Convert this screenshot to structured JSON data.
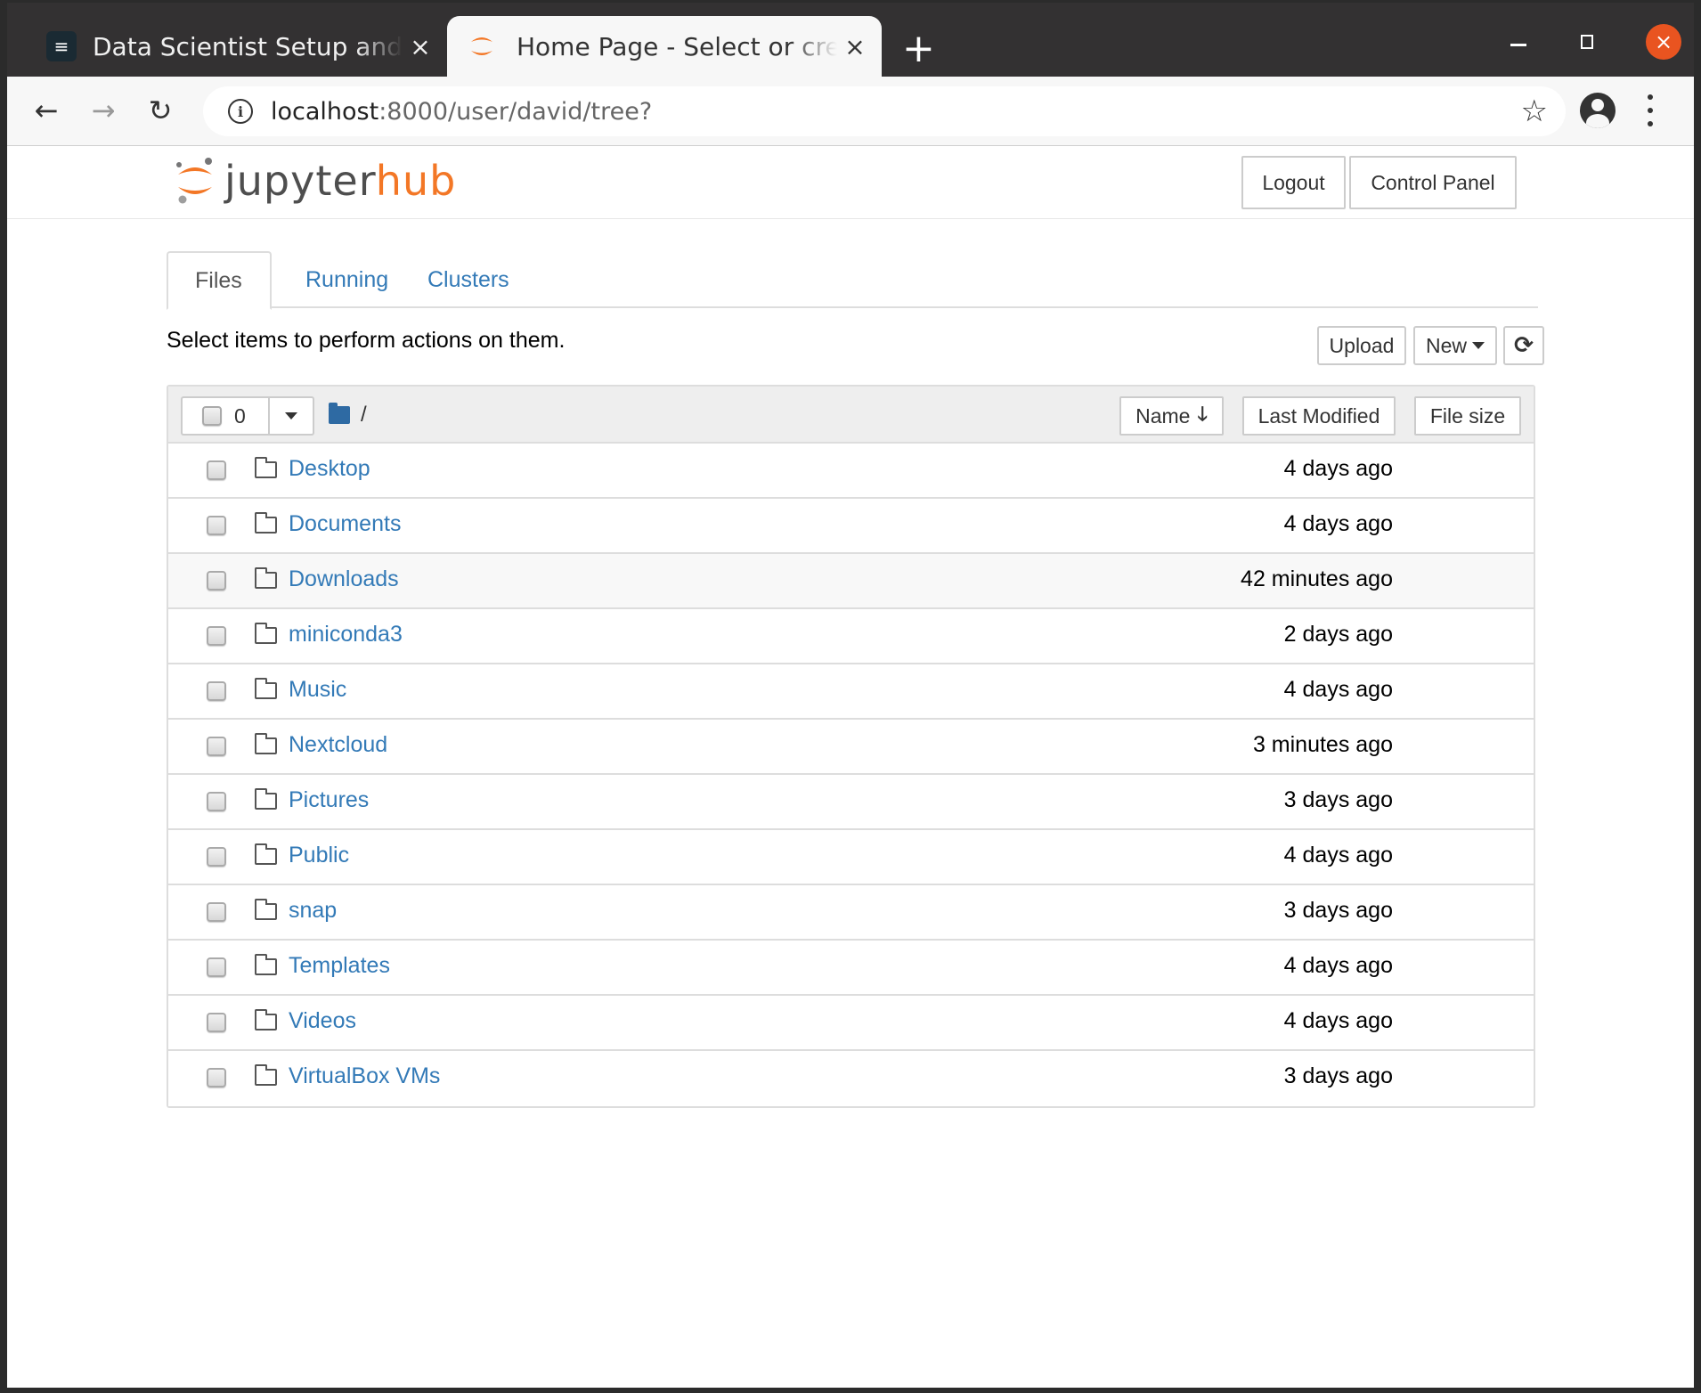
{
  "browser": {
    "tabs": [
      {
        "title": "Data Scientist Setup and Daily",
        "icon": "document-icon",
        "active": false
      },
      {
        "title": "Home Page - Select or create a notebook",
        "icon": "jupyter-icon",
        "active": true
      }
    ],
    "new_tab_label": "+",
    "url_host": "localhost",
    "url_rest": ":8000/user/david/tree?",
    "close_glyph": "×",
    "accent_close": "#e95420"
  },
  "header": {
    "logo_primary": "jupyter",
    "logo_secondary": "hub",
    "logout_label": "Logout",
    "control_panel_label": "Control Panel"
  },
  "tabs": [
    {
      "label": "Files",
      "active": true
    },
    {
      "label": "Running",
      "active": false
    },
    {
      "label": "Clusters",
      "active": false
    }
  ],
  "toolbar": {
    "hint": "Select items to perform actions on them.",
    "upload_label": "Upload",
    "new_label": "New",
    "refresh_icon": "refresh-icon"
  },
  "list": {
    "selected_count": "0",
    "breadcrumb_root": "/",
    "sort_name_label": "Name",
    "sort_modified_label": "Last Modified",
    "sort_size_label": "File size",
    "rows": [
      {
        "name": "Desktop",
        "modified": "4 days ago",
        "type": "folder"
      },
      {
        "name": "Documents",
        "modified": "4 days ago",
        "type": "folder"
      },
      {
        "name": "Downloads",
        "modified": "42 minutes ago",
        "type": "folder"
      },
      {
        "name": "miniconda3",
        "modified": "2 days ago",
        "type": "folder"
      },
      {
        "name": "Music",
        "modified": "4 days ago",
        "type": "folder"
      },
      {
        "name": "Nextcloud",
        "modified": "3 minutes ago",
        "type": "folder"
      },
      {
        "name": "Pictures",
        "modified": "3 days ago",
        "type": "folder"
      },
      {
        "name": "Public",
        "modified": "4 days ago",
        "type": "folder"
      },
      {
        "name": "snap",
        "modified": "3 days ago",
        "type": "folder"
      },
      {
        "name": "Templates",
        "modified": "4 days ago",
        "type": "folder"
      },
      {
        "name": "Videos",
        "modified": "4 days ago",
        "type": "folder"
      },
      {
        "name": "VirtualBox VMs",
        "modified": "3 days ago",
        "type": "folder"
      }
    ]
  },
  "colors": {
    "link": "#337ab7",
    "brand_orange": "#f37726"
  }
}
